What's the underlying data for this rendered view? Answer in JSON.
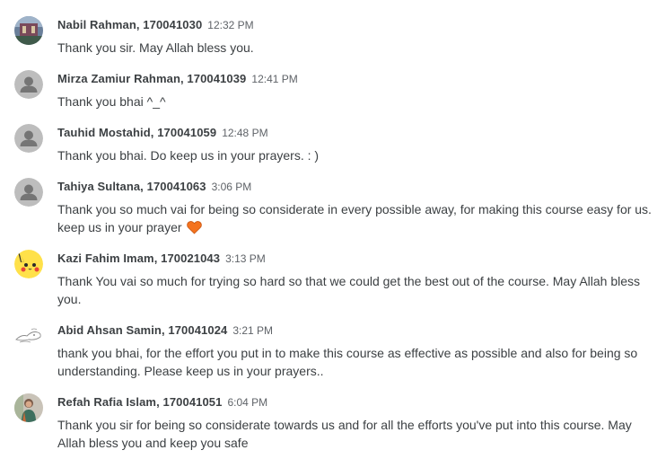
{
  "comments": [
    {
      "author": "Nabil Rahman, 170041030",
      "time": "12:32 PM",
      "text": "Thank you sir. May Allah bless you.",
      "avatar": "photo-avatar-landscape"
    },
    {
      "author": "Mirza Zamiur Rahman, 170041039",
      "time": "12:41 PM",
      "text": "Thank you bhai ^_^",
      "avatar": "default-person-avatar"
    },
    {
      "author": "Tauhid Mostahid, 170041059",
      "time": "12:48 PM",
      "text": "Thank you bhai. Do keep us in your prayers. : )",
      "avatar": "default-person-avatar"
    },
    {
      "author": "Tahiya Sultana, 170041063",
      "time": "3:06 PM",
      "text": "Thank you so much vai for being so considerate in every possible away, for making this course easy for us. keep us in your prayer",
      "emoji": "orange-heart-icon",
      "avatar": "default-person-avatar"
    },
    {
      "author": "Kazi Fahim Imam, 170021043",
      "time": "3:13 PM",
      "text": "Thank You vai so much for trying so hard so that we could get the best out of the course. May Allah bless you.",
      "avatar": "pikachu-avatar"
    },
    {
      "author": "Abid Ahsan Samin, 170041024",
      "time": "3:21 PM",
      "text": "thank you bhai, for the effort you put in to make this course as effective as possible and also for being so understanding. Please keep us in your prayers..",
      "avatar": "sketch-avatar"
    },
    {
      "author": "Refah Rafia Islam, 170041051",
      "time": "6:04 PM",
      "text": "Thank you sir for being so considerate towards us and for all the efforts you've put into this course. May Allah bless you and keep you safe",
      "avatar": "photo-avatar-person"
    }
  ],
  "colors": {
    "author": "#3c4043",
    "time": "#5f6368",
    "text": "#3c4043",
    "default_avatar_bg": "#bdbdbd",
    "default_avatar_fg": "#757575",
    "heart": "#f4731f"
  }
}
